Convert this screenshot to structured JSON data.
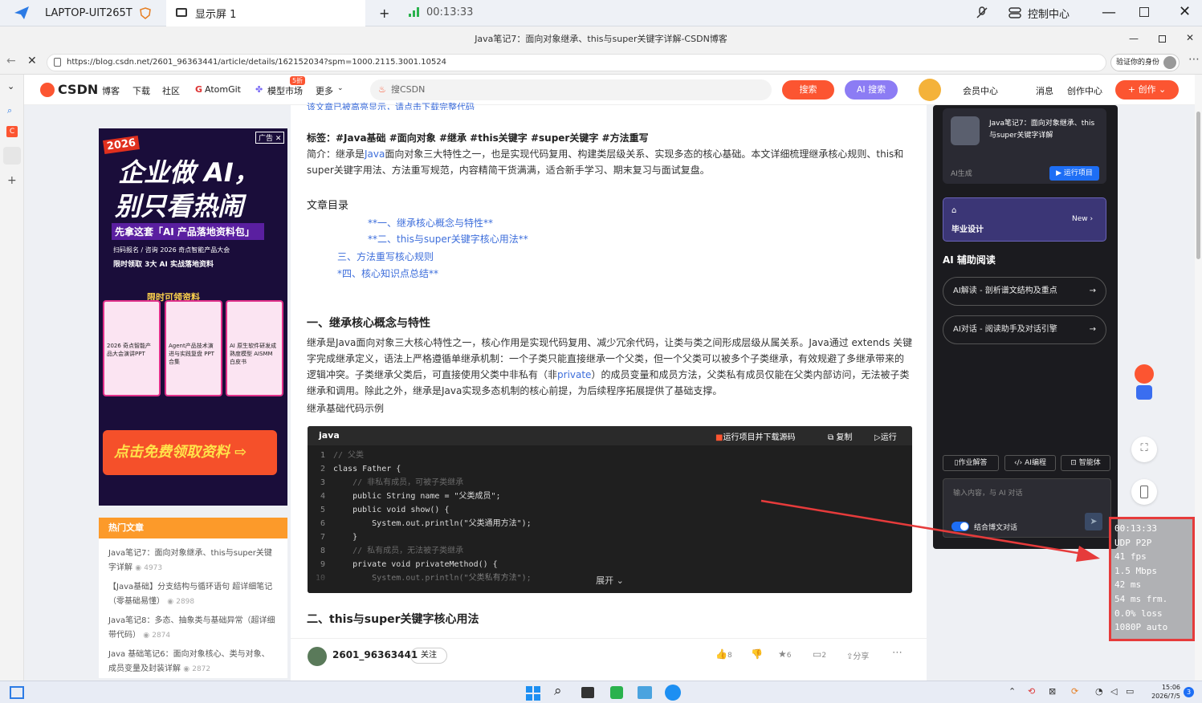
{
  "remote": {
    "host_tab": "LAPTOP-UIT265T",
    "screen_tab": "显示屏 1",
    "timer": "00:13:33",
    "control_center": "控制中心"
  },
  "browser": {
    "window_title": "Java笔记7：面向对象继承、this与super关键字详解-CSDN博客",
    "url": "https://blog.csdn.net/2601_96363441/article/details/162152034?spm=1000.2115.3001.10524",
    "profile_label": "验证你的身份"
  },
  "csdn_nav": {
    "logo": "CSDN",
    "items": [
      "博客",
      "下载",
      "社区",
      "AtomGit",
      "模型市场",
      "更多"
    ],
    "badge": "5折",
    "search_placeholder": "搜CSDN",
    "search_button": "搜索",
    "ai_search_button": "AI 搜索",
    "member_center": "会员中心",
    "messages": "消息",
    "creation_center": "创作中心",
    "create_button": "创作"
  },
  "ad": {
    "year": "2026",
    "ad_tag": "广告",
    "headline1": "企业做 AI，",
    "headline2": "别只看热闹",
    "subtitle": "先拿这套「AI 产品落地资料包」",
    "line1": "扫码报名 / 咨询 2026 奇点智能产品大会",
    "line2": "限时领取 3大 AI 实战落地资料",
    "limited": "限时可领资料",
    "card1_title": "2026 奇点智能产品大会演讲PPT",
    "card2_title": "Agent产品技术演进与实践复盘 PPT合集",
    "card3_title": "AI 原生软件研发成熟度模型 AISMM 白皮书",
    "cta": "点击免费领取资料"
  },
  "hot": {
    "title": "热门文章",
    "items": [
      {
        "title": "Java笔记7：面向对象继承、this与super关键字详解",
        "views": "4973"
      },
      {
        "title": "【Java基础】分支结构与循环语句 超详细笔记（零基础易懂）",
        "views": "2898"
      },
      {
        "title": "Java笔记8：多态、抽象类与基础异常（超详细带代码）",
        "views": "2874"
      },
      {
        "title": "Java 基础笔记6：面向对象核心、类与对象、成员变量及封装详解",
        "views": "2872"
      }
    ]
  },
  "article": {
    "top_partial": "该文章已被高亮显示，请点击下载完整代码",
    "tags": "标签：#Java基础 #面向对象 #继承 #this关键字 #super关键字 #方法重写",
    "summary_prefix": "简介：继承是",
    "summary_link": "Java",
    "summary_rest": "面向对象三大特性之一，也是实现代码复用、构建类层级关系、实现多态的核心基础。本文详细梳理继承核心规则、this和super关键字用法、方法重写规范，内容精简干货满满，适合新手学习、期末复习与面试复盘。",
    "toc_title": "文章目录",
    "toc": [
      "**一、继承核心概念与特性**",
      "**二、this与super关键字核心用法**",
      "三、方法重写核心规则",
      "*四、核心知识点总结**"
    ],
    "h1": "一、继承核心概念与特性",
    "para_a": "继承是Java面向对象三大核心特性之一，核心作用是实现代码复用、减少冗余代码，让类与类之间形成层级从属关系。Java通过 extends 关键字完成继承定义，语法上严格遵循单继承机制：一个子类只能直接继承一个父类，但一个父类可以被多个子类继承，有效规避了多继承带来的逻辑冲突。子类继承父类后，可直接使用父类中非私有（非",
    "para_link": "private",
    "para_b": "）的成员变量和成员方法，父类私有成员仅能在父类内部访问，无法被子类继承和调用。除此之外，继承是Java实现多态机制的核心前提，为后续程序拓展提供了基础支撑。",
    "code_intro": "继承基础代码示例",
    "h2": "二、this与super关键字核心用法"
  },
  "code": {
    "lang": "java",
    "run_download": "运行项目并下载源码",
    "copy": "复制",
    "run": "运行",
    "expand": "展开",
    "lines": [
      "// 父类",
      "class Father {",
      "    // 非私有成员，可被子类继承",
      "    public String name = \"父类成员\";",
      "    public void show() {",
      "        System.out.println(\"父类通用方法\");",
      "    }",
      "    // 私有成员，无法被子类继承",
      "    private void privateMethod() {",
      "        System.out.println(\"父类私有方法\");"
    ]
  },
  "author": {
    "name": "2601_96363441",
    "follow": "关注",
    "likes": "8",
    "stars": "6",
    "comments": "2",
    "share": "分享"
  },
  "right": {
    "card_title": "Java笔记7：面向对象继承、this与super关键字详解",
    "ai_generated": "AI生成",
    "run_project": "运行项目",
    "grad_title": "毕业设计",
    "new": "New",
    "ai_assist": "AI 辅助阅读",
    "btn1": "AI解读 - 剖析谱文结构及重点",
    "btn2": "AI对话 - 阅读助手及对话引擎",
    "tool1": "作业解答",
    "tool2": "AI编程",
    "tool3": "智能体",
    "input_placeholder": "输入内容，与 AI 对话",
    "toggle_label": "结合博文对话"
  },
  "overlay": {
    "lines": [
      "00:13:33",
      "UDP P2P",
      "41 fps",
      "1.5 Mbps",
      "42 ms",
      "54 ms frm.",
      "0.0% loss",
      "1080P auto"
    ]
  },
  "taskbar": {
    "time": "15:06",
    "date": "2026/7/5",
    "notif": "3"
  },
  "colors": {
    "accent": "#fc5531",
    "ai": "#7b6cf6",
    "link": "#3d6edb",
    "overlay_border": "#e63b3b"
  }
}
